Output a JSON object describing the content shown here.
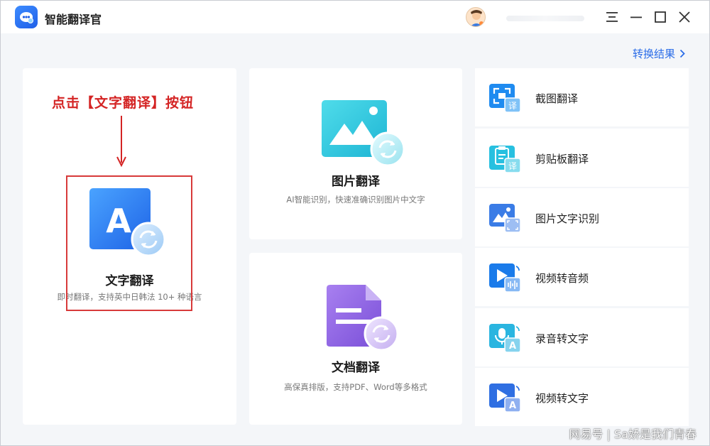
{
  "app": {
    "title": "智能翻译官"
  },
  "header": {
    "result_link": "转换结果"
  },
  "annotation": {
    "text": "点击【文字翻译】按钮"
  },
  "cards": {
    "text_translate": {
      "title": "文字翻译",
      "desc": "即时翻译，支持英中日韩法 10+ 种语言",
      "icon_letter": "A"
    },
    "image_translate": {
      "title": "图片翻译",
      "desc": "AI智能识别，快速准确识别图片中文字"
    },
    "doc_translate": {
      "title": "文档翻译",
      "desc": "高保真排版，支持PDF、Word等多格式"
    }
  },
  "tools": [
    {
      "label": "截图翻译",
      "icon": "screenshot-translate-icon",
      "badge": "译"
    },
    {
      "label": "剪贴板翻译",
      "icon": "clipboard-translate-icon",
      "badge": "译"
    },
    {
      "label": "图片文字识别",
      "icon": "image-ocr-icon",
      "badge": ""
    },
    {
      "label": "视频转音频",
      "icon": "video-to-audio-icon",
      "badge": ""
    },
    {
      "label": "录音转文字",
      "icon": "recording-to-text-icon",
      "badge": "A"
    },
    {
      "label": "视频转文字",
      "icon": "video-to-text-icon",
      "badge": "A"
    }
  ],
  "watermark": "网易号 | Sa娇是我们青春",
  "colors": {
    "accent": "#2b6de8",
    "annotation_red": "#d42424",
    "background": "#f4f6f9"
  }
}
